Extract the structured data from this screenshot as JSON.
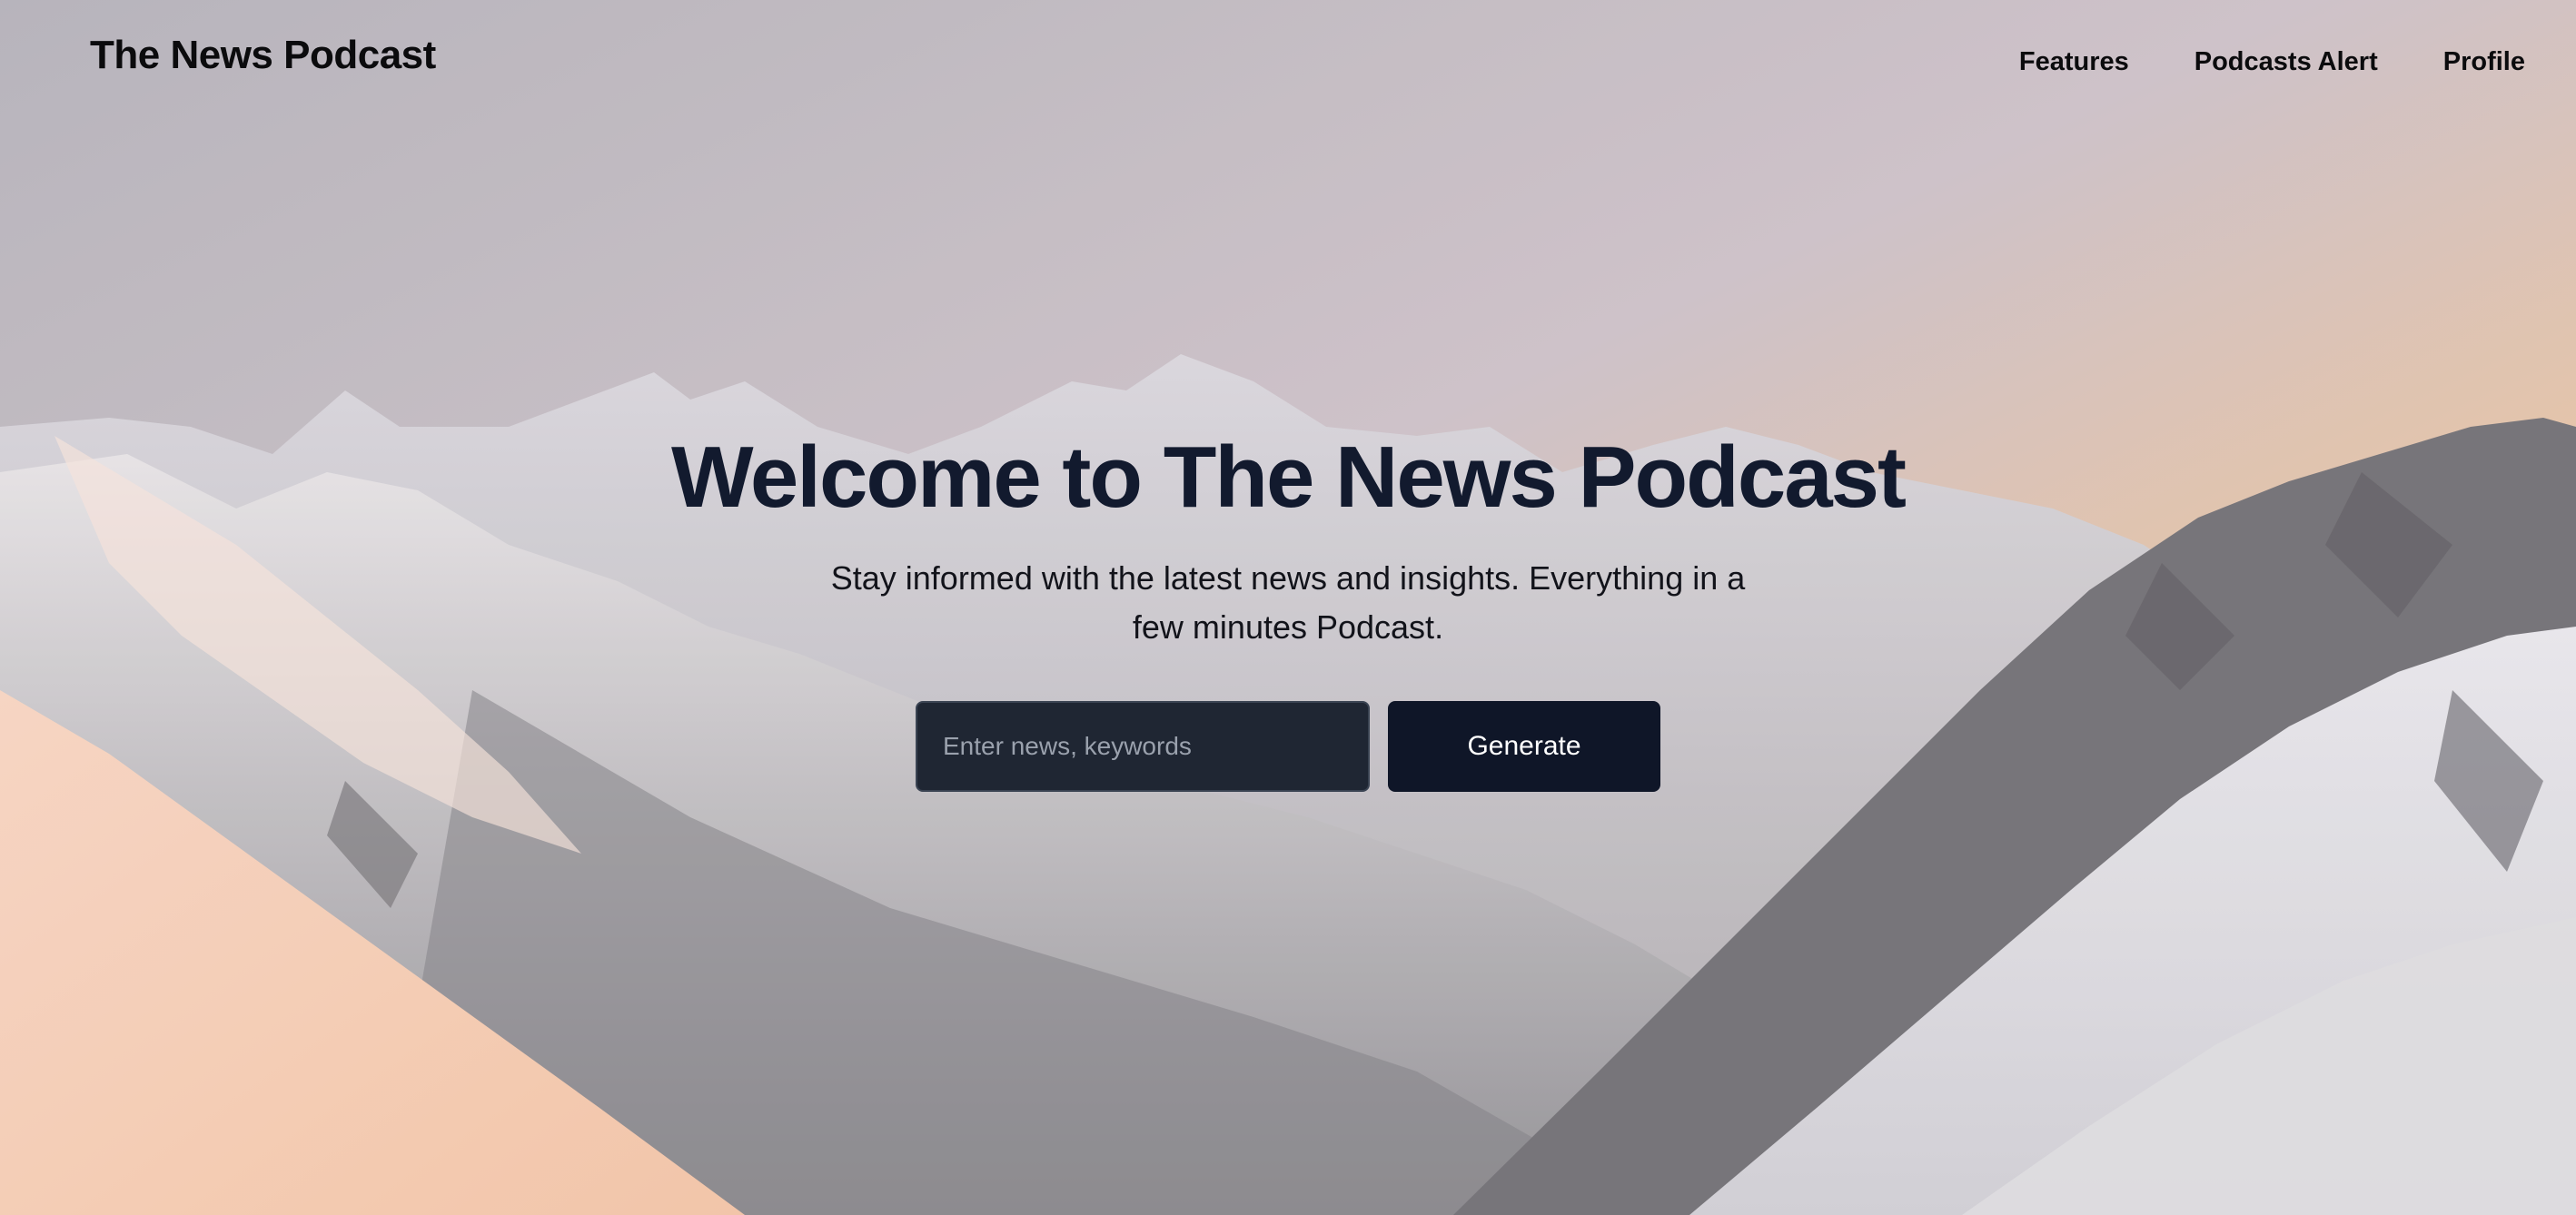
{
  "brand": {
    "name": "The News Podcast"
  },
  "nav": {
    "items": [
      {
        "label": "Features"
      },
      {
        "label": "Podcasts Alert"
      },
      {
        "label": "Profile"
      }
    ]
  },
  "hero": {
    "title": "Welcome to The News Podcast",
    "subtitle": "Stay informed with the latest news and insights. Everything in a few minutes Podcast.",
    "search": {
      "value": "",
      "placeholder": "Enter news, keywords"
    },
    "generate_label": "Generate",
    "background": "snowy-mountain-range-sunset-image"
  },
  "colors": {
    "title": "#121a2e",
    "button_bg": "#0f1628",
    "input_bg": "#1f2633",
    "sky_warm": "#f3c18f"
  }
}
